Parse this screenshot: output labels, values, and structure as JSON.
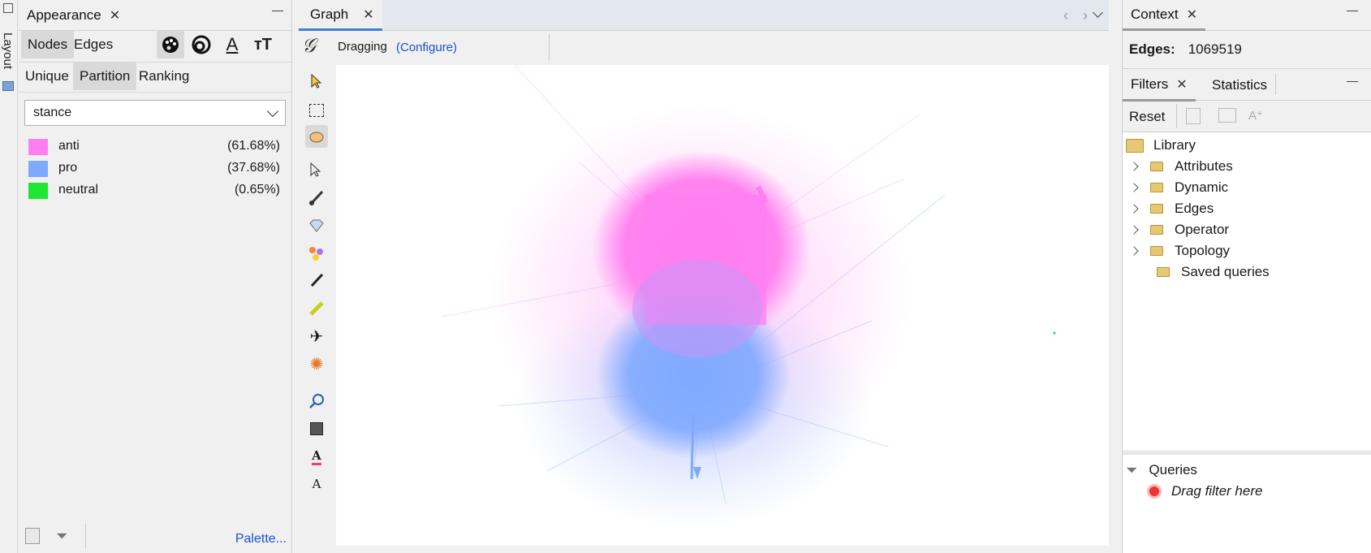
{
  "left_strip": {
    "label": "Layout"
  },
  "appearance": {
    "tab_title": "Appearance",
    "element_tabs": [
      "Nodes",
      "Edges"
    ],
    "mode_tabs": [
      "Unique",
      "Partition",
      "Ranking"
    ],
    "attribute_select": "stance",
    "legend": [
      {
        "name": "anti",
        "percent": "(61.68%)",
        "color": "#ff7ff0"
      },
      {
        "name": "pro",
        "percent": "(37.68%)",
        "color": "#7fa9ff"
      },
      {
        "name": "neutral",
        "percent": "(0.65%)",
        "color": "#1fe633"
      }
    ],
    "palette_link": "Palette..."
  },
  "graph": {
    "tab_title": "Graph",
    "toolbar": {
      "mode": "Dragging",
      "configure": "(Configure)"
    }
  },
  "context": {
    "tab_title": "Context",
    "edges_label": "Edges:",
    "edges_value": "1069519"
  },
  "filters": {
    "tabs": [
      "Filters",
      "Statistics"
    ],
    "reset": "Reset",
    "library": "Library",
    "tree": [
      "Attributes",
      "Dynamic",
      "Edges",
      "Operator",
      "Topology",
      "Saved queries"
    ],
    "queries": "Queries",
    "drag_hint": "Drag filter here"
  },
  "colors": {
    "accent": "#3c7fd6",
    "link": "#1a4fd6",
    "anti": "#ff7ff0",
    "pro": "#7fa9ff",
    "neutral": "#1fe633"
  }
}
